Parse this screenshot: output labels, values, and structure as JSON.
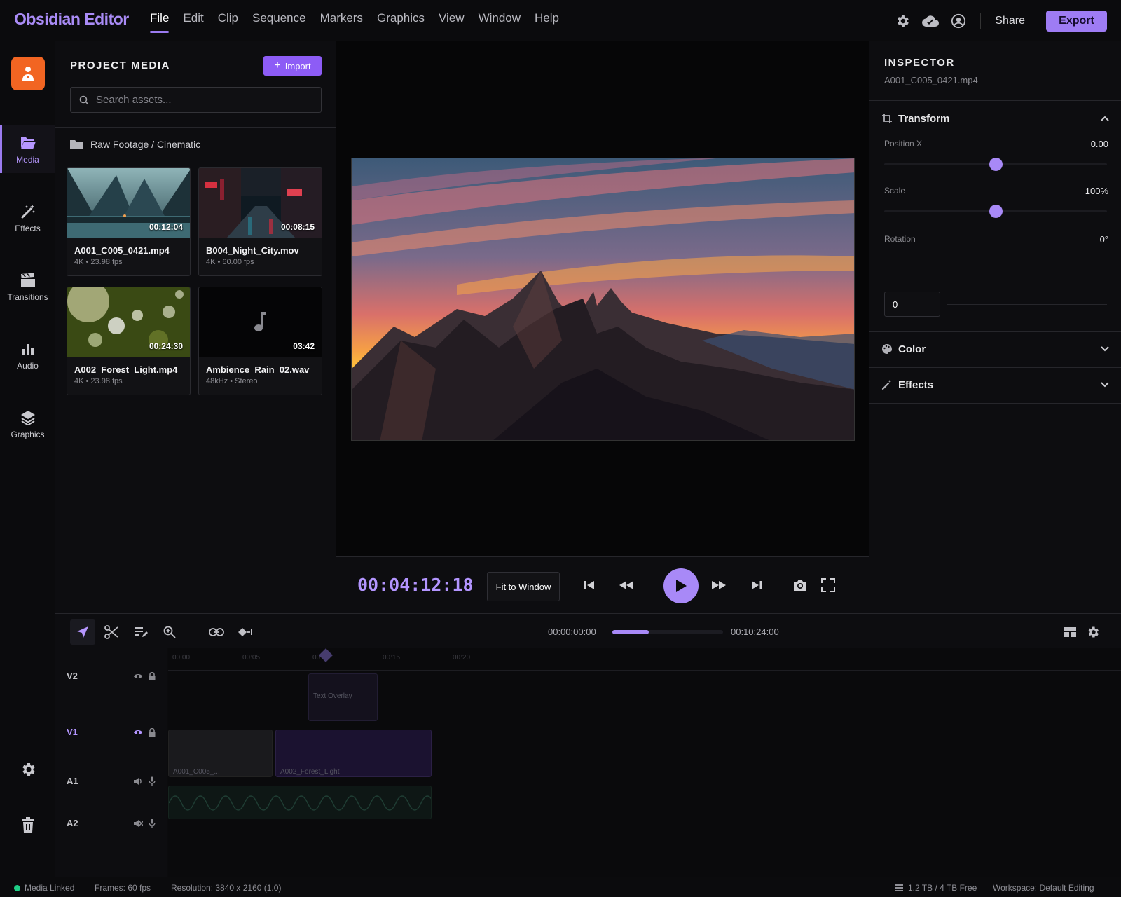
{
  "app": {
    "name": "Obsidian Editor"
  },
  "menu": [
    "File",
    "Edit",
    "Clip",
    "Sequence",
    "Markers",
    "Graphics",
    "View",
    "Window",
    "Help"
  ],
  "active_menu": "File",
  "topbar": {
    "share_label": "Share",
    "export_label": "Export"
  },
  "rail": {
    "items": [
      {
        "label": "Media",
        "icon": "folder-open-icon",
        "active": true
      },
      {
        "label": "Effects",
        "icon": "magic-wand-icon"
      },
      {
        "label": "Transitions",
        "icon": "clapperboard-icon"
      },
      {
        "label": "Audio",
        "icon": "bar-chart-icon"
      },
      {
        "label": "Graphics",
        "icon": "layers-icon"
      }
    ]
  },
  "media": {
    "title": "PROJECT MEDIA",
    "import_label": "Import",
    "search_placeholder": "Search assets...",
    "folder": "Raw Footage / Cinematic",
    "items": [
      {
        "name": "A001_C005_0421.mp4",
        "meta": "4K • 23.98 fps",
        "duration": "00:12:04"
      },
      {
        "name": "B004_Night_City.mov",
        "meta": "4K • 60.00 fps",
        "duration": "00:08:15"
      },
      {
        "name": "A002_Forest_Light.mp4",
        "meta": "4K • 23.98 fps",
        "duration": "00:24:30"
      },
      {
        "name": "Ambience_Rain_02.wav",
        "meta": "48kHz • Stereo",
        "duration": "03:42"
      }
    ]
  },
  "viewer": {
    "timecode": "00:04:12:18",
    "fit_label": "Fit to Window"
  },
  "inspector": {
    "title": "INSPECTOR",
    "file": "A001_C005_0421.mp4",
    "sections": {
      "transform": "Transform",
      "color": "Color",
      "effects": "Effects"
    },
    "position_x": {
      "label": "Position X",
      "value": "0.00",
      "level": 0.5
    },
    "scale": {
      "label": "Scale",
      "value": "100%",
      "level": 0.5
    },
    "rotation": {
      "label": "Rotation",
      "value": "0°",
      "input": "0"
    }
  },
  "timeline": {
    "start": "00:00:00:00",
    "end": "00:10:24:00",
    "progress": 0.33,
    "ruler": [
      "00:00",
      "00:05",
      "00:10",
      "00:15",
      "00:20"
    ],
    "tracks": [
      {
        "name": "V2"
      },
      {
        "name": "V1",
        "active": true
      },
      {
        "name": "A1"
      },
      {
        "name": "A2"
      }
    ],
    "clips": {
      "overlay": "Text Overlay",
      "v1a": "A001_C005_...",
      "v1b": "A002_Forest_Light"
    }
  },
  "status": {
    "linked": "Media Linked",
    "frames": "Frames: 60 fps",
    "resolution": "Resolution: 3840 x 2160 (1.0)",
    "storage": "1.2 TB / 4 TB Free",
    "workspace": "Workspace: Default Editing"
  },
  "colors": {
    "accent": "#a889f7",
    "brand": "#f26522",
    "status_ok": "#1fcf86"
  }
}
